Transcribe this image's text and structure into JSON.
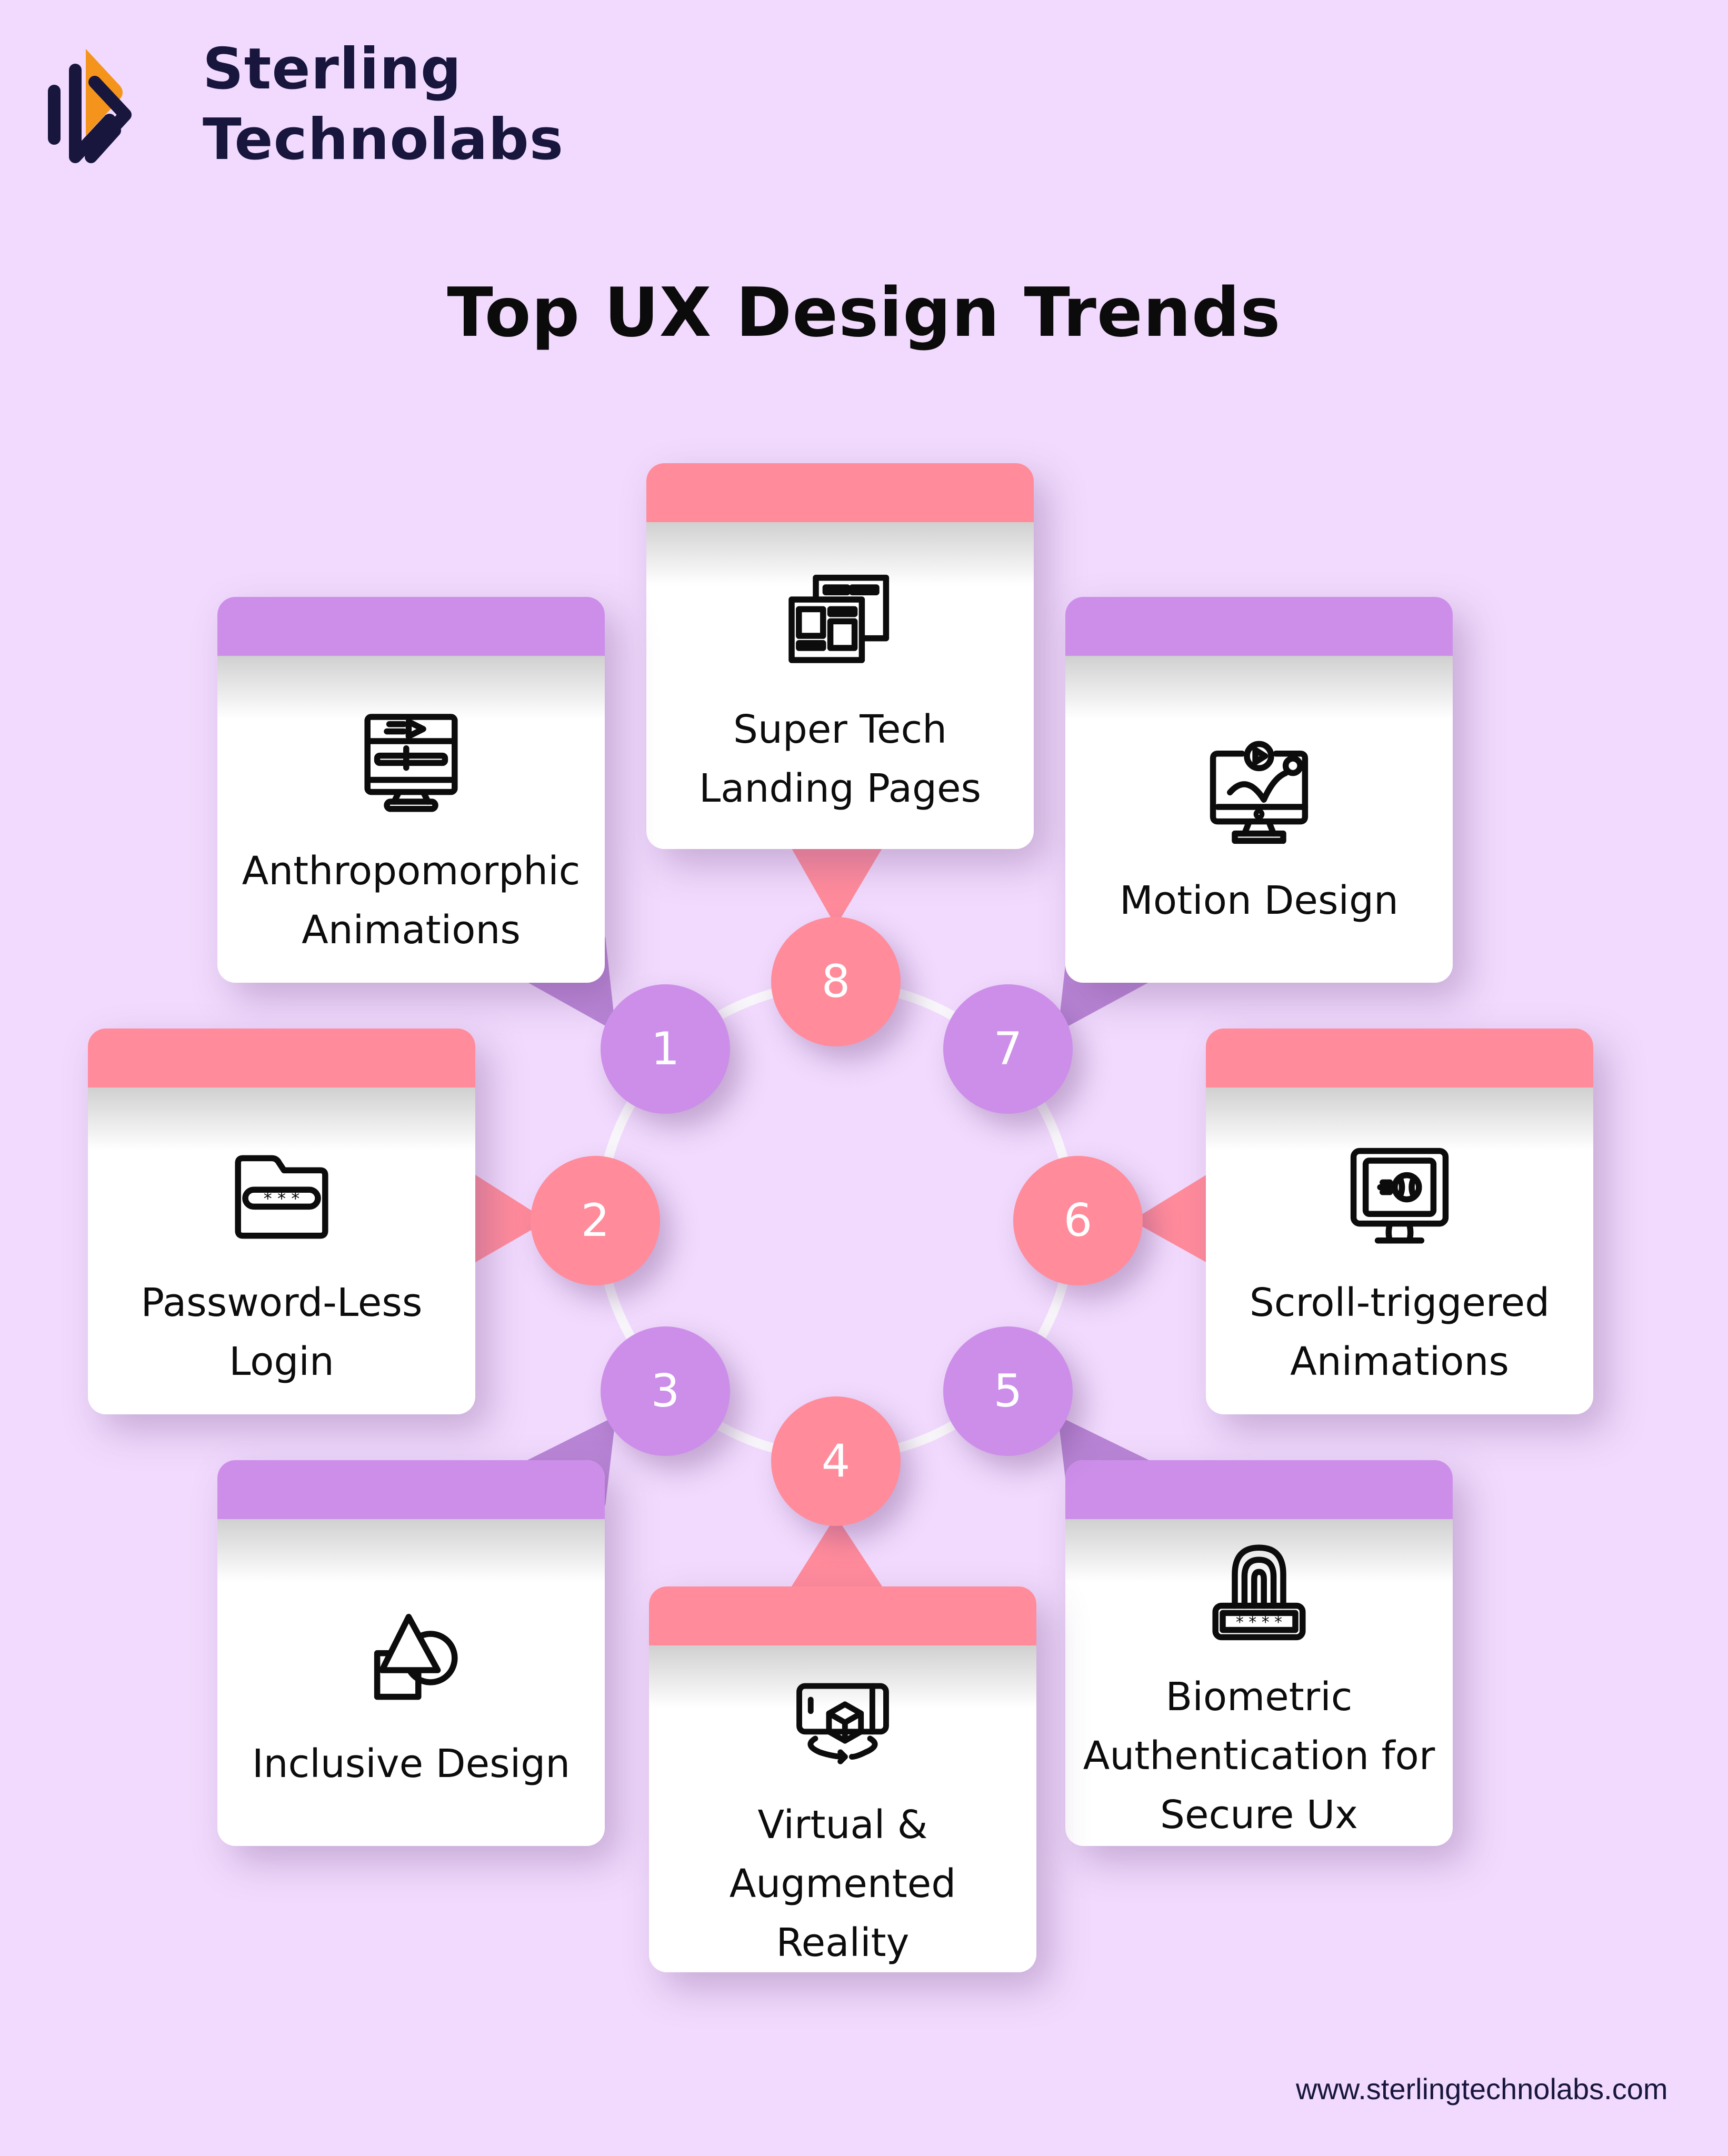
{
  "brand": {
    "name_line1": "Sterling",
    "name_line2": "Technolabs",
    "logo_colors": {
      "accent": "#f4941c",
      "dark": "#18163d"
    }
  },
  "title": "Top UX Design Trends",
  "colors": {
    "background": "#f1dafd",
    "pink": "#ff8b9b",
    "purple": "#cd8eea",
    "ring": "#f8f6fa",
    "text": "#0c0c0c"
  },
  "trends": [
    {
      "number": "1",
      "label": "Anthropomorphic Animations",
      "icon": "monitor-video-timeline-icon",
      "color": "purple"
    },
    {
      "number": "2",
      "label": "Password-Less Login",
      "icon": "folder-password-icon",
      "color": "pink"
    },
    {
      "number": "3",
      "label": "Inclusive Design",
      "icon": "shapes-icon",
      "color": "purple"
    },
    {
      "number": "4",
      "label": "Virtual & Augmented Reality",
      "icon": "phone-ar-cube-icon",
      "color": "pink"
    },
    {
      "number": "5",
      "label": "Biometric Authentication for Secure Ux",
      "icon": "fingerprint-password-icon",
      "color": "purple"
    },
    {
      "number": "6",
      "label": "Scroll-triggered Animations",
      "icon": "monitor-ball-icon",
      "color": "pink"
    },
    {
      "number": "7",
      "label": "Motion Design",
      "icon": "monitor-motion-icon",
      "color": "purple"
    },
    {
      "number": "8",
      "label": "Super Tech Landing Pages",
      "icon": "browser-windows-icon",
      "color": "pink"
    }
  ],
  "footer": {
    "url": "www.sterlingtechnolabs.com"
  }
}
